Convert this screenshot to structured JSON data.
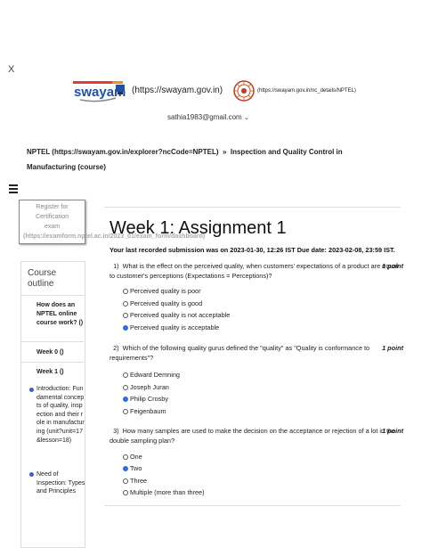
{
  "close_label": "X",
  "header": {
    "logo_text": "swayam",
    "swayam_link": "(https://swayam.gov.in)",
    "nptel_link": "(https://swayam.gov.in/nc_details/NPTEL)",
    "email": "sathia1983@gmail.com"
  },
  "breadcrumb": {
    "part1": "NPTEL (https://swayam.gov.in/explorer?ncCode=NPTEL)",
    "separator": "»",
    "part2": "Inspection and Quality Control in Manufacturing (course)"
  },
  "register": {
    "label": "Register for Certification exam",
    "url": "(https://examform.nptel.ac.in/2023_01/exam_form/dashboard)"
  },
  "sidebar": {
    "heading": "Course outline",
    "items": [
      {
        "label": "How does an NPTEL online course work? ()"
      },
      {
        "label": "Week 0 ()"
      },
      {
        "label": "Week 1 ()"
      }
    ],
    "sub_items": [
      {
        "label": "Introduction: Fundamental concepts of quality, inspection and their role in manufacturing (unit?unit=17&lesson=18)"
      },
      {
        "label": "Need of Inspection: Types and Principles"
      }
    ]
  },
  "assignment": {
    "title": "Week 1: Assignment 1",
    "submission_text": "Your last recorded submission was on 2023-01-30, 12:26 IST Due date: 2023-02-08, 23:59 IST.",
    "questions": [
      {
        "number": "1)",
        "text": "What is the effect on the perceived quality, when customers' expectations of a product are equal to customer's perceptions (Expectations = Perceptions)?",
        "points": "1 point",
        "options": [
          "Perceived quality is poor",
          "Perceived quality is good",
          "Perceived quality is not acceptable",
          "Perceived quality is acceptable"
        ],
        "selected": 3
      },
      {
        "number": "2)",
        "text": "Which of the following quality gurus defined the \"quality\" as \"Quality is conformance to requirements\"?",
        "points": "1 point",
        "options": [
          "Edward Demning",
          "Joseph Juran",
          "Philip Crosby",
          "Feigenbaum"
        ],
        "selected": 2
      },
      {
        "number": "3)",
        "text": "How many samples are used to make the decision on the acceptance or rejection of a lot in the double sampling plan?",
        "points": "1 point",
        "options": [
          "One",
          "Two",
          "Three",
          "Multiple (more than three)"
        ],
        "selected": 1
      }
    ]
  },
  "colors": {
    "accent": "#2f6fd6",
    "logo_blue": "#1f4fa8",
    "logo_orange": "#f28c28"
  }
}
